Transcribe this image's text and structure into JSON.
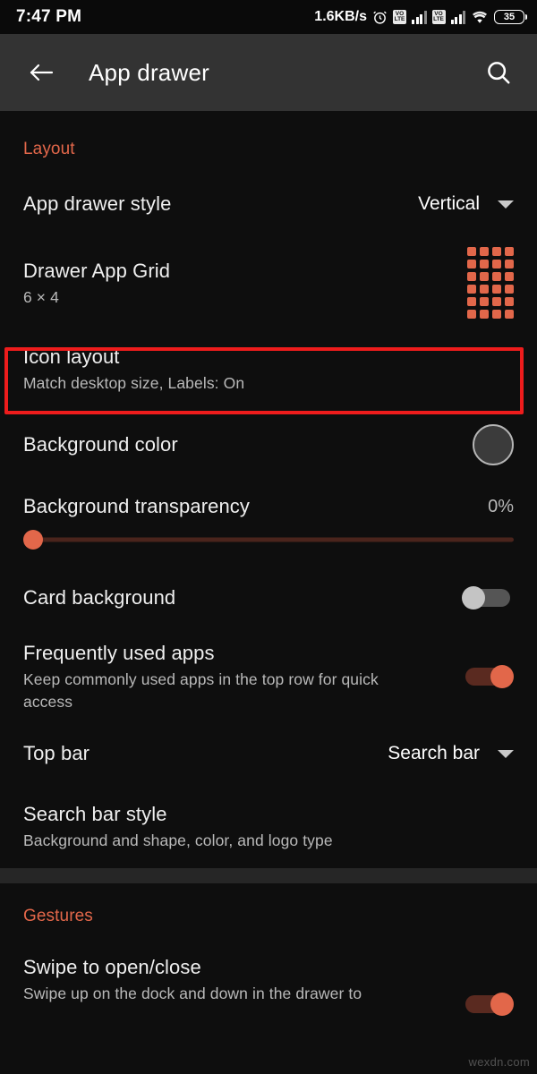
{
  "status_bar": {
    "time": "7:47 PM",
    "network_speed": "1.6KB/s",
    "alarm_icon": "alarm-clock-icon",
    "sim1_network": "VoLTE",
    "sim2_network": "VoLTE",
    "wifi_icon": "wifi-icon",
    "battery_level": "35"
  },
  "app_bar": {
    "back_icon": "back-arrow-icon",
    "title": "App drawer",
    "search_icon": "search-icon"
  },
  "sections": [
    {
      "title": "Layout",
      "rows": [
        {
          "label": "App drawer style",
          "value": "Vertical",
          "control": "dropdown"
        },
        {
          "label": "Drawer App Grid",
          "sub": "6 × 4",
          "control": "grid-preview",
          "grid_columns": 4,
          "grid_rows": 6,
          "grid_color": "#e2674a"
        },
        {
          "label": "Icon layout",
          "sub": "Match desktop size, Labels: On",
          "control": "none",
          "highlighted": true
        },
        {
          "label": "Background color",
          "control": "color-swatch",
          "swatch_color": "#3b3b3b"
        },
        {
          "label": "Background transparency",
          "value": "0%",
          "control": "slider",
          "slider_percent": 0
        },
        {
          "label": "Card background",
          "control": "toggle",
          "toggle_on": false
        },
        {
          "label": "Frequently used apps",
          "sub": "Keep commonly used apps in the top row for quick access",
          "control": "toggle",
          "toggle_on": true
        },
        {
          "label": "Top bar",
          "value": "Search bar",
          "control": "dropdown"
        },
        {
          "label": "Search bar style",
          "sub": "Background and shape, color, and logo type",
          "control": "none"
        }
      ]
    },
    {
      "title": "Gestures",
      "rows": [
        {
          "label": "Swipe to open/close",
          "sub": "Swipe up on the dock and down in the drawer to",
          "control": "toggle",
          "toggle_on": true
        }
      ]
    }
  ],
  "watermark": "wexdn.com",
  "colors": {
    "accent": "#e2674a",
    "highlight_box": "#ee1c1c",
    "background": "#0e0e0e",
    "appbar": "#333333"
  }
}
